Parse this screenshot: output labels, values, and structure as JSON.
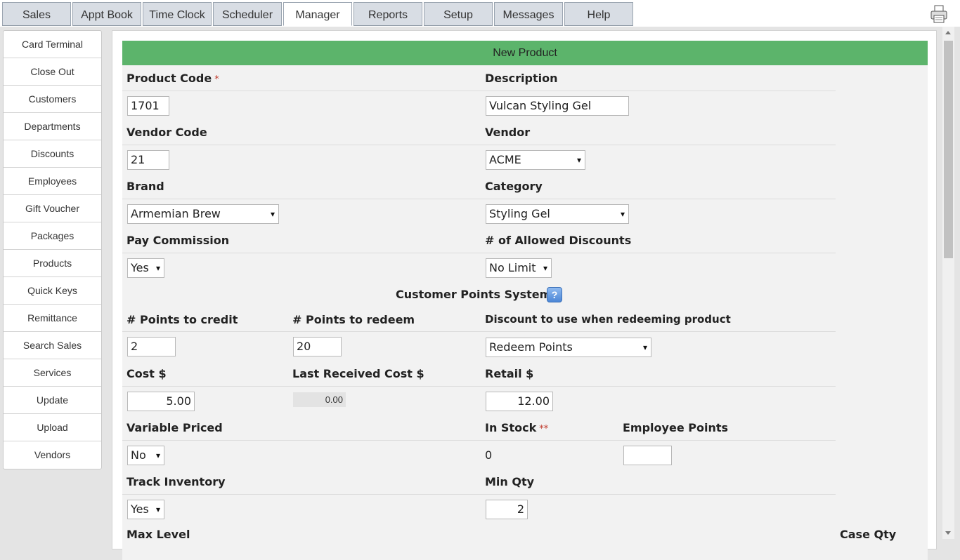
{
  "tabs": [
    {
      "label": "Sales",
      "active": false
    },
    {
      "label": "Appt Book",
      "active": false
    },
    {
      "label": "Time Clock",
      "active": false
    },
    {
      "label": "Scheduler",
      "active": false
    },
    {
      "label": "Manager",
      "active": true
    },
    {
      "label": "Reports",
      "active": false
    },
    {
      "label": "Setup",
      "active": false
    },
    {
      "label": "Messages",
      "active": false
    },
    {
      "label": "Help",
      "active": false
    }
  ],
  "sidebar": {
    "items": [
      "Card Terminal",
      "Close Out",
      "Customers",
      "Departments",
      "Discounts",
      "Employees",
      "Gift Voucher",
      "Packages",
      "Products",
      "Quick Keys",
      "Remittance",
      "Search Sales",
      "Services",
      "Update",
      "Upload",
      "Vendors"
    ]
  },
  "form": {
    "title": "New Product",
    "product_code": {
      "label": "Product Code",
      "required": "*",
      "value": "1701"
    },
    "description": {
      "label": "Description",
      "value": "Vulcan Styling Gel"
    },
    "vendor_code": {
      "label": "Vendor Code",
      "value": "21"
    },
    "vendor": {
      "label": "Vendor",
      "value": "ACME"
    },
    "brand": {
      "label": "Brand",
      "value": "Armemian Brew"
    },
    "category": {
      "label": "Category",
      "value": "Styling Gel"
    },
    "pay_commission": {
      "label": "Pay Commission",
      "value": "Yes"
    },
    "allowed_discounts": {
      "label": "# of Allowed Discounts",
      "value": "No Limit"
    },
    "points_section": {
      "label": "Customer Points System",
      "help_icon": "?"
    },
    "points_credit": {
      "label": "# Points to credit",
      "value": "2"
    },
    "points_redeem": {
      "label": "# Points to redeem",
      "value": "20"
    },
    "redeem_discount": {
      "label": "Discount to use when redeeming product",
      "value": "Redeem Points"
    },
    "cost": {
      "label": "Cost $",
      "value": "5.00"
    },
    "last_received_cost": {
      "label": "Last Received Cost $",
      "value": "0.00"
    },
    "retail": {
      "label": "Retail $",
      "value": "12.00"
    },
    "variable_priced": {
      "label": "Variable Priced",
      "value": "No"
    },
    "in_stock": {
      "label": "In Stock",
      "required": "**",
      "value": "0"
    },
    "employee_points": {
      "label": "Employee Points",
      "value": ""
    },
    "track_inventory": {
      "label": "Track Inventory",
      "value": "Yes"
    },
    "min_qty": {
      "label": "Min Qty",
      "value": "2"
    },
    "max_level": {
      "label": "Max Level"
    },
    "case_qty": {
      "label": "Case Qty"
    }
  },
  "colors": {
    "header_green": "#5cb46b",
    "form_bg": "#f2f2f2",
    "required_red": "#c0392b"
  },
  "icons": {
    "printer": "printer-icon",
    "help": "help-icon"
  }
}
